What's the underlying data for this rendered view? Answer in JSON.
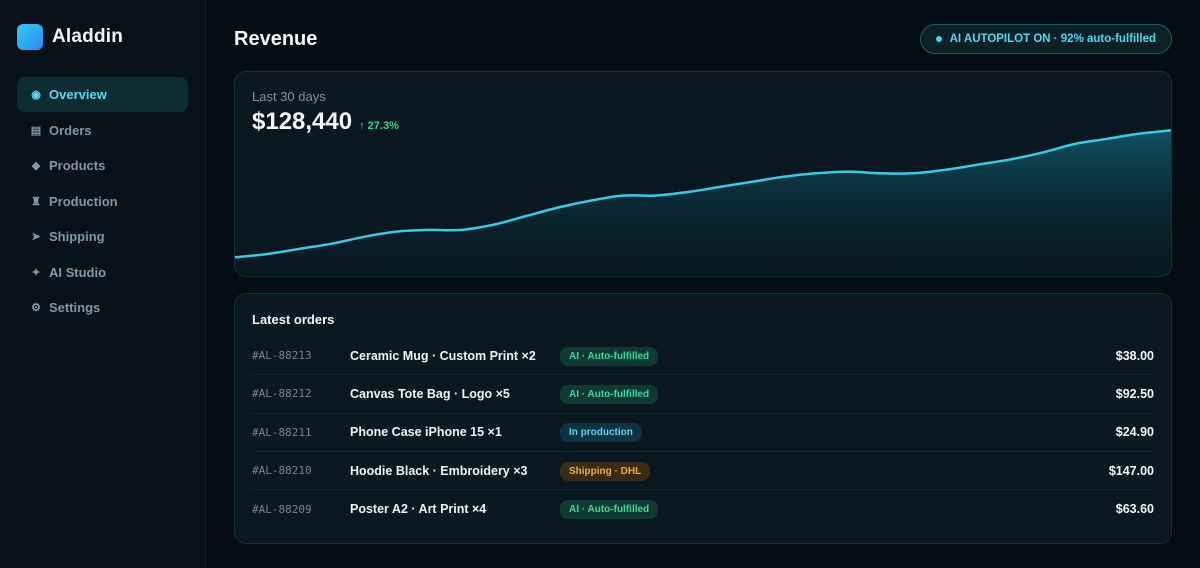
{
  "brand": {
    "name": "Aladdin"
  },
  "sidebar": {
    "items": [
      {
        "label": "Overview",
        "icon": "◉",
        "icon_name": "overview-icon",
        "active": true
      },
      {
        "label": "Orders",
        "icon": "▤",
        "icon_name": "orders-icon",
        "active": false
      },
      {
        "label": "Products",
        "icon": "◆",
        "icon_name": "products-icon",
        "active": false
      },
      {
        "label": "Production",
        "icon": "♜",
        "icon_name": "production-icon",
        "active": false
      },
      {
        "label": "Shipping",
        "icon": "➤",
        "icon_name": "shipping-icon",
        "active": false
      },
      {
        "label": "AI Studio",
        "icon": "✦",
        "icon_name": "sparkle-icon",
        "active": false
      },
      {
        "label": "Settings",
        "icon": "⚙",
        "icon_name": "gear-icon",
        "active": false
      }
    ]
  },
  "header": {
    "title": "Revenue",
    "autopilot_label": "AI AUTOPILOT ON · 92% auto-fulfilled"
  },
  "revenue": {
    "period": "Last 30 days",
    "amount": "$128,440",
    "change": "↑ 27.3%"
  },
  "chart_data": {
    "type": "area",
    "title": "",
    "xlabel": "",
    "ylabel": "",
    "x": [
      1,
      2,
      3,
      4,
      5,
      6,
      7,
      8,
      9,
      10,
      11,
      12,
      13,
      14,
      15,
      16,
      17,
      18,
      19,
      20,
      21,
      22,
      23,
      24,
      25,
      26,
      27,
      28,
      29,
      30
    ],
    "series": [
      {
        "values": [
          12,
          14,
          17,
          20,
          24,
          27,
          28,
          28,
          31,
          36,
          41,
          45,
          48,
          48,
          50,
          53,
          56,
          59,
          61,
          62,
          61,
          61,
          63,
          66,
          69,
          73,
          78,
          81,
          84,
          86
        ]
      }
    ],
    "ylim": [
      0,
      120
    ],
    "grid": false,
    "colors": {
      "line": "#3cc9e4",
      "fill": "#0f4b5a"
    }
  },
  "orders": {
    "title": "Latest orders",
    "rows": [
      {
        "id": "#AL-88213",
        "product": "Ceramic Mug · Custom Print ×2",
        "status": "AI · Auto-fulfilled",
        "status_kind": "green",
        "amount": "$38.00"
      },
      {
        "id": "#AL-88212",
        "product": "Canvas Tote Bag · Logo ×5",
        "status": "AI · Auto-fulfilled",
        "status_kind": "green",
        "amount": "$92.50"
      },
      {
        "id": "#AL-88211",
        "product": "Phone Case iPhone 15 ×1",
        "status": "In production",
        "status_kind": "blue",
        "amount": "$24.90"
      },
      {
        "id": "#AL-88210",
        "product": "Hoodie Black · Embroidery ×3",
        "status": "Shipping · DHL",
        "status_kind": "orange",
        "amount": "$147.00"
      },
      {
        "id": "#AL-88209",
        "product": "Poster A2 · Art Print ×4",
        "status": "AI · Auto-fulfilled",
        "status_kind": "green",
        "amount": "$63.60"
      }
    ]
  },
  "colors": {
    "accent": "#3fd4ef",
    "background": "#050d14",
    "success": "#36d49a",
    "warning": "#f0ac3a"
  }
}
